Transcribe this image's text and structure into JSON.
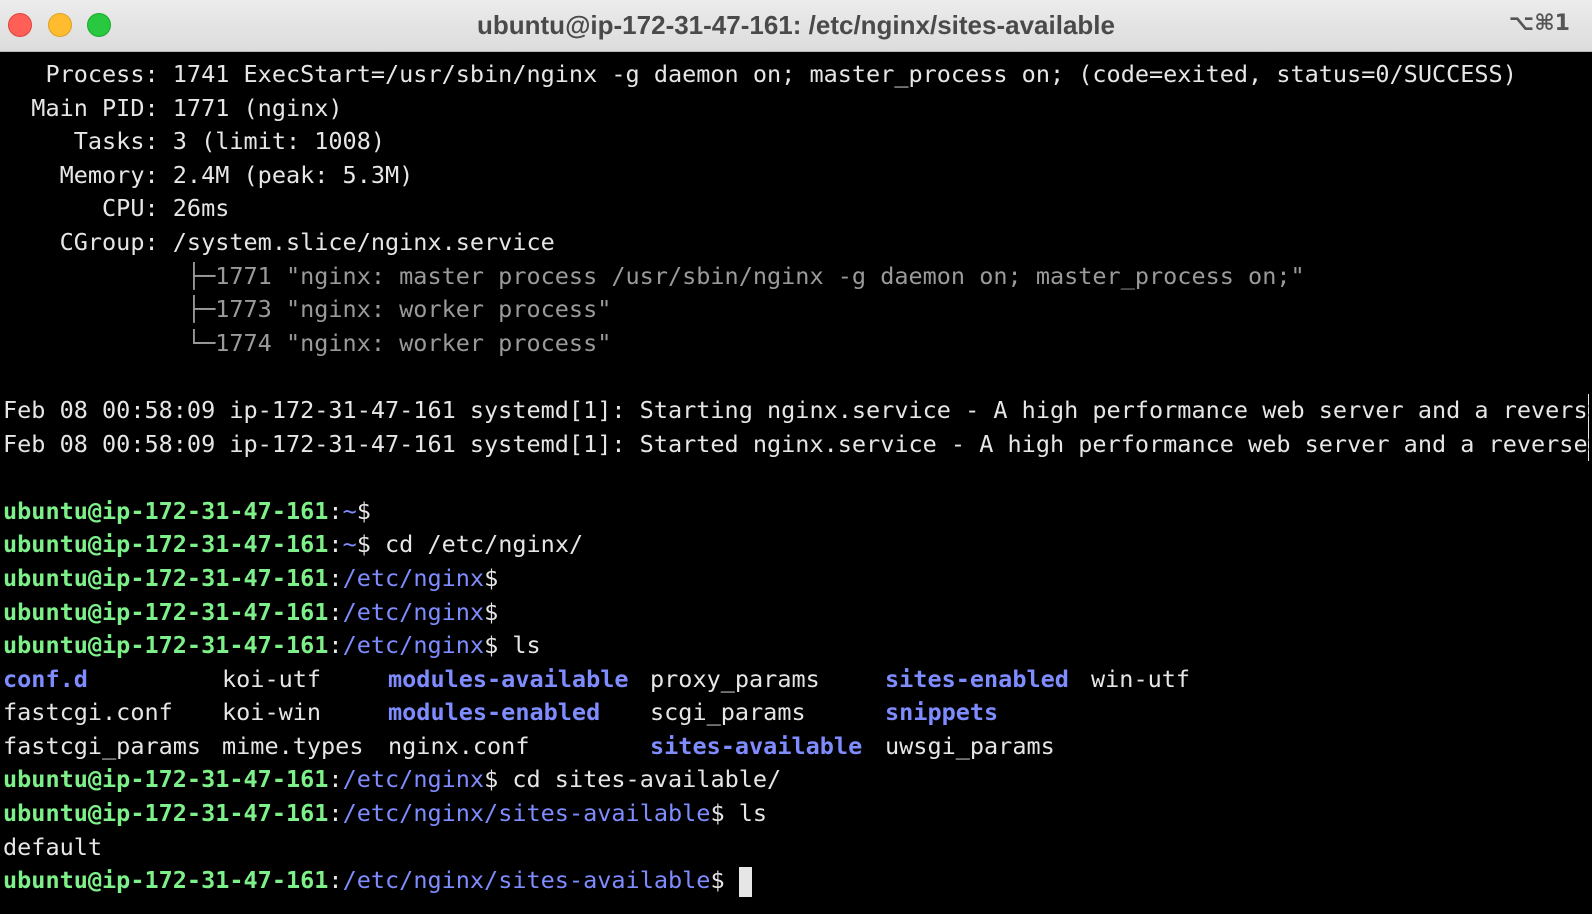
{
  "window": {
    "title": "ubuntu@ip-172-31-47-161: /etc/nginx/sites-available",
    "shortcut": "⌥⌘1"
  },
  "status": {
    "process": "   Process: 1741 ExecStart=/usr/sbin/nginx -g daemon on; master_process on; (code=exited, status=0/SUCCESS)",
    "main_pid": "  Main PID: 1771 (nginx)",
    "tasks": "     Tasks: 3 (limit: 1008)",
    "memory": "    Memory: 2.4M (peak: 5.3M)",
    "cpu": "       CPU: 26ms",
    "cgroup": "    CGroup: /system.slice/nginx.service",
    "tree": [
      "             ├─1771 \"nginx: master process /usr/sbin/nginx -g daemon on; master_process on;\"",
      "             ├─1773 \"nginx: worker process\"",
      "             └─1774 \"nginx: worker process\""
    ]
  },
  "logs": [
    "Feb 08 00:58:09 ip-172-31-47-161 systemd[1]: Starting nginx.service - A high performance web server and a revers",
    "Feb 08 00:58:09 ip-172-31-47-161 systemd[1]: Started nginx.service - A high performance web server and a reverse"
  ],
  "truncation_marker": ">",
  "prompt": {
    "user_host": "ubuntu@ip-172-31-47-161",
    "colon": ":",
    "dollar": "$",
    "home": "~",
    "nginx": "/etc/nginx",
    "sites": "/etc/nginx/sites-available"
  },
  "commands": {
    "cd_nginx": " cd /etc/nginx/",
    "ls": " ls",
    "cd_sites": " cd sites-available/"
  },
  "ls_nginx": [
    [
      {
        "text": "conf.d",
        "dir": true
      },
      {
        "text": "koi-utf",
        "dir": false
      },
      {
        "text": "modules-available",
        "dir": true
      },
      {
        "text": "proxy_params",
        "dir": false
      },
      {
        "text": "sites-enabled",
        "dir": true
      },
      {
        "text": "win-utf",
        "dir": false
      }
    ],
    [
      {
        "text": "fastcgi.conf",
        "dir": false
      },
      {
        "text": "koi-win",
        "dir": false
      },
      {
        "text": "modules-enabled",
        "dir": true
      },
      {
        "text": "scgi_params",
        "dir": false
      },
      {
        "text": "snippets",
        "dir": true
      }
    ],
    [
      {
        "text": "fastcgi_params",
        "dir": false
      },
      {
        "text": "mime.types",
        "dir": false
      },
      {
        "text": "nginx.conf",
        "dir": false
      },
      {
        "text": "sites-available",
        "dir": true
      },
      {
        "text": "uwsgi_params",
        "dir": false
      }
    ]
  ],
  "ls_sites": "default",
  "colors": {
    "prompt_user": "#7ef08a",
    "prompt_path": "#7f8cff",
    "directory": "#7f8cff",
    "text": "#e6e6e6",
    "dim": "#9a9a9a",
    "close": "#fe5f57",
    "minimize": "#febc2e",
    "maximize": "#28c840"
  }
}
